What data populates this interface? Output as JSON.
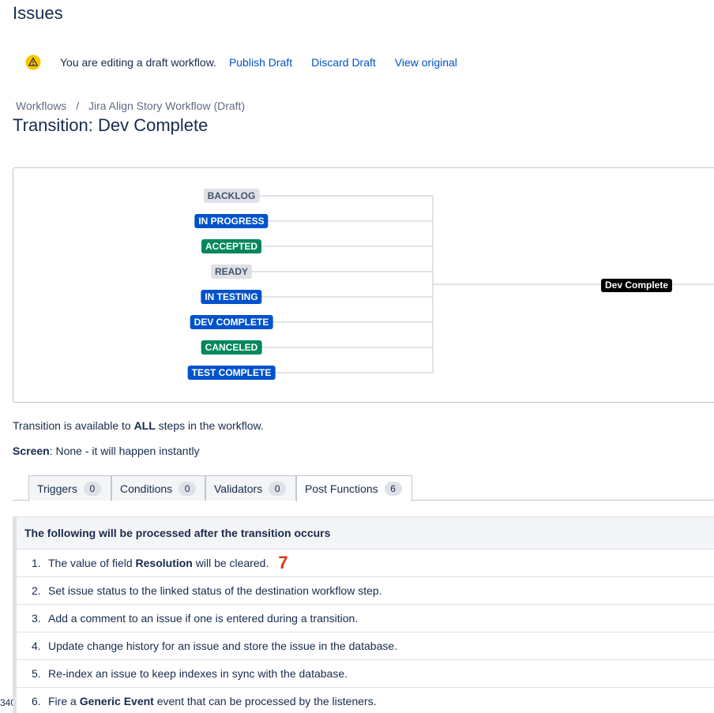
{
  "header": {
    "title": "Issues"
  },
  "draft_banner": {
    "message": "You are editing a draft workflow.",
    "publish": "Publish Draft",
    "discard": "Discard Draft",
    "view_original": "View original"
  },
  "breadcrumb": {
    "root": "Workflows",
    "separator": "/",
    "current": "Jira Align Story Workflow (Draft)"
  },
  "transition_title": "Transition: Dev Complete",
  "diagram": {
    "statuses": [
      {
        "label": "BACKLOG",
        "category": "grey"
      },
      {
        "label": "IN PROGRESS",
        "category": "blue"
      },
      {
        "label": "ACCEPTED",
        "category": "green"
      },
      {
        "label": "READY",
        "category": "grey"
      },
      {
        "label": "IN TESTING",
        "category": "blue"
      },
      {
        "label": "DEV COMPLETE",
        "category": "blue"
      },
      {
        "label": "CANCELED",
        "category": "green"
      },
      {
        "label": "TEST COMPLETE",
        "category": "blue"
      }
    ],
    "destination_label": "Dev Complete",
    "colors": {
      "grey": "#dfe1e6",
      "blue": "#0052cc",
      "green": "#00875a"
    }
  },
  "info": {
    "availability_prefix": "Transition is available to",
    "availability_bold": "ALL",
    "availability_suffix": "steps in the workflow.",
    "screen_label": "Screen",
    "screen_value": ": None - it will happen instantly"
  },
  "tabs": [
    {
      "label": "Triggers",
      "count": "0"
    },
    {
      "label": "Conditions",
      "count": "0"
    },
    {
      "label": "Validators",
      "count": "0"
    },
    {
      "label": "Post Functions",
      "count": "6",
      "active": true
    }
  ],
  "post_functions": {
    "heading": "The following will be processed after the transition occurs",
    "items": [
      {
        "num": "1.",
        "pre": "The value of field ",
        "bold": "Resolution",
        "post": " will be cleared."
      },
      {
        "num": "2.",
        "pre": "Set issue status to the linked status of the destination workflow step.",
        "bold": "",
        "post": ""
      },
      {
        "num": "3.",
        "pre": "Add a comment to an issue if one is entered during a transition.",
        "bold": "",
        "post": ""
      },
      {
        "num": "4.",
        "pre": "Update change history for an issue and store the issue in the database.",
        "bold": "",
        "post": ""
      },
      {
        "num": "5.",
        "pre": "Re-index an issue to keep indexes in sync with the database.",
        "bold": "",
        "post": ""
      },
      {
        "num": "6.",
        "pre": "Fire a ",
        "bold": "Generic Event",
        "post": " event that can be processed by the listeners."
      }
    ],
    "annotation_marker": "7"
  },
  "edge_fragment": "340"
}
